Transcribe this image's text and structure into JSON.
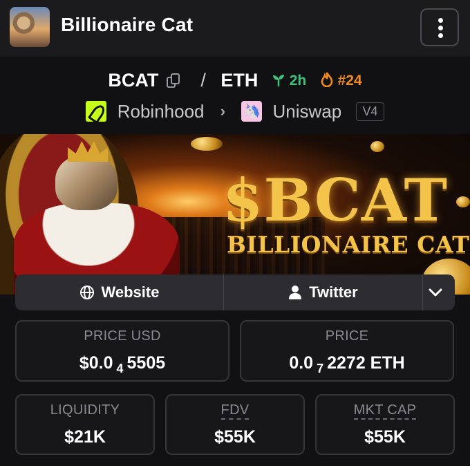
{
  "header": {
    "title": "Billionaire Cat"
  },
  "pair": {
    "base": "BCAT",
    "separator": "/",
    "quote": "ETH",
    "age": "2h",
    "rank": "#24",
    "chain": "Robinhood",
    "dex": "Uniswap",
    "version": "V4"
  },
  "banner": {
    "title": "$BCAT",
    "subtitle": "BILLIONAIRE CAT"
  },
  "links": {
    "website": "Website",
    "twitter": "Twitter"
  },
  "stats": {
    "price_usd": {
      "label": "PRICE USD",
      "prefix": "$0.0",
      "zeros": "4",
      "digits": "5505"
    },
    "price": {
      "label": "PRICE",
      "prefix": "0.0",
      "zeros": "7",
      "digits": "2272 ETH"
    },
    "liquidity": {
      "label": "LIQUIDITY",
      "value": "$21K"
    },
    "fdv": {
      "label": "FDV",
      "value": "$55K"
    },
    "mkt_cap": {
      "label": "MKT CAP",
      "value": "$55K"
    }
  },
  "colors": {
    "age_green": "#3ec27a",
    "rank_orange": "#f28a1e",
    "robinhood_green": "#c6ff1a",
    "banner_gold": "#f4c44a"
  }
}
